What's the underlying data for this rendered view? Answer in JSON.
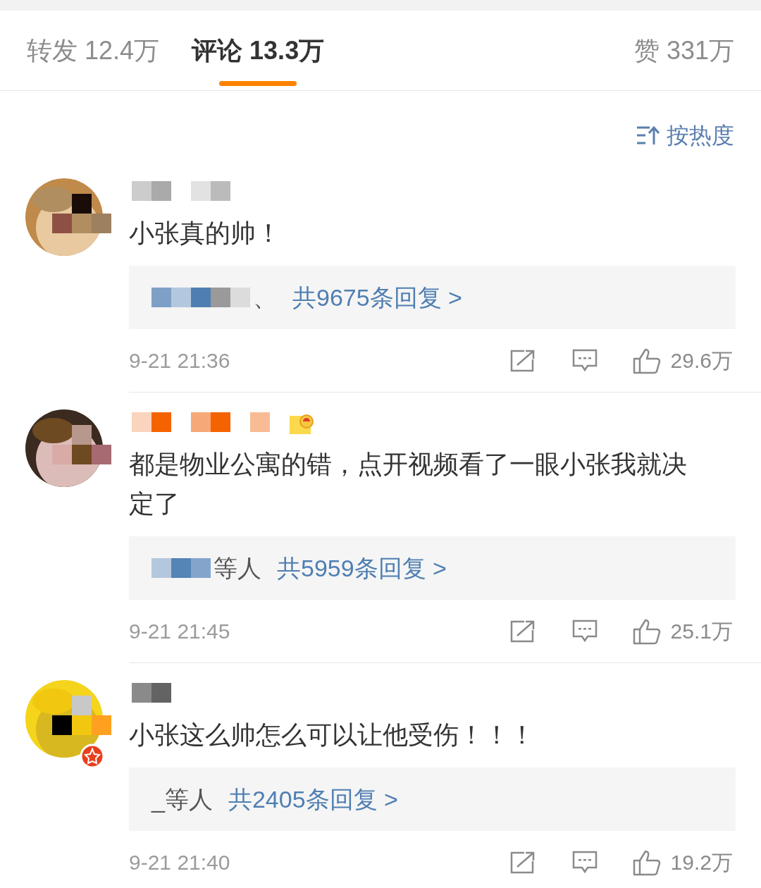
{
  "tabs": [
    {
      "label": "转发",
      "count": "12.4万",
      "selected": false
    },
    {
      "label": "评论",
      "count": "13.3万",
      "selected": true
    },
    {
      "label": "赞",
      "count": "331万",
      "selected": false
    }
  ],
  "sort": {
    "label": "按热度"
  },
  "comments": [
    {
      "medal": false,
      "verified": false,
      "text": "小张真的帅！",
      "reply_preview": "、",
      "reply_count": "共9675条回复 >",
      "time": "9-21 21:36",
      "likes": "29.6万"
    },
    {
      "medal": true,
      "verified": false,
      "text": "都是物业公寓的错，点开视频看了一眼小张我就决定了",
      "reply_preview": "等人",
      "reply_count": "共5959条回复 >",
      "time": "9-21 21:45",
      "likes": "25.1万"
    },
    {
      "medal": false,
      "verified": true,
      "text": "小张这么帅怎么可以让他受伤！！！",
      "reply_preview": "_等人",
      "reply_count": "共2405条回复 >",
      "time": "9-21 21:40",
      "likes": "19.2万"
    }
  ]
}
